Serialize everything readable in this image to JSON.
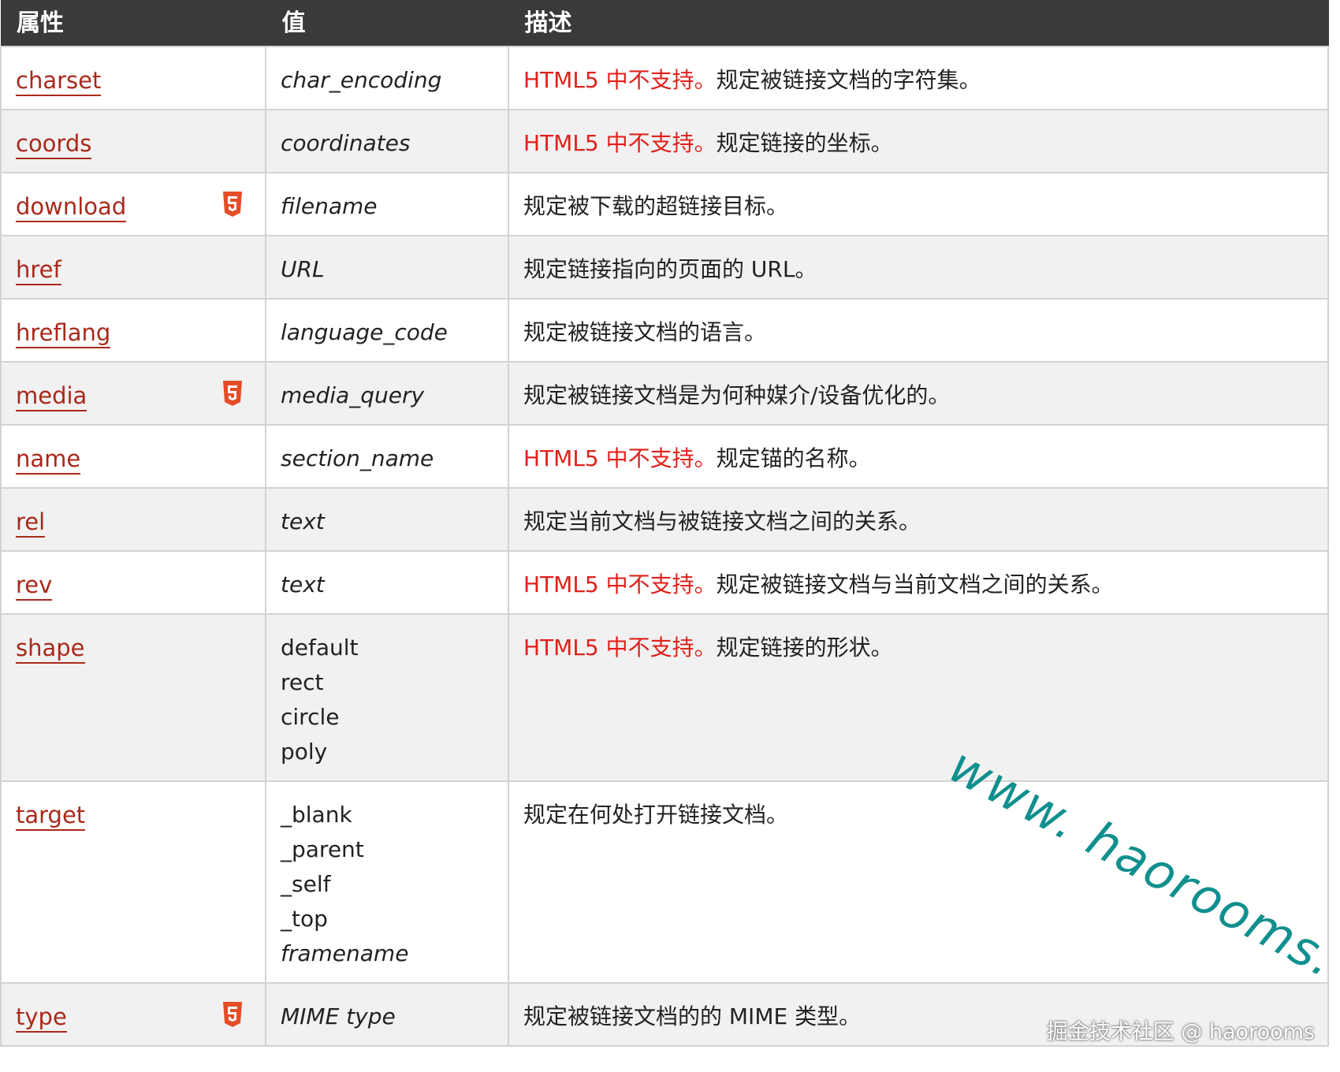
{
  "header": {
    "col_attr": "属性",
    "col_value": "值",
    "col_desc": "描述"
  },
  "rows": [
    {
      "attr": "charset",
      "html5": false,
      "values": [
        "char_encoding"
      ],
      "values_italic": [
        true
      ],
      "unsupported": "HTML5 中不支持。",
      "desc": "规定被链接文档的字符集。"
    },
    {
      "attr": "coords",
      "html5": false,
      "values": [
        "coordinates"
      ],
      "values_italic": [
        true
      ],
      "unsupported": "HTML5 中不支持。",
      "desc": "规定链接的坐标。"
    },
    {
      "attr": "download",
      "html5": true,
      "values": [
        "filename"
      ],
      "values_italic": [
        true
      ],
      "unsupported": "",
      "desc": "规定被下载的超链接目标。"
    },
    {
      "attr": "href",
      "html5": false,
      "values": [
        "URL"
      ],
      "values_italic": [
        true
      ],
      "unsupported": "",
      "desc": "规定链接指向的页面的 URL。"
    },
    {
      "attr": "hreflang",
      "html5": false,
      "values": [
        "language_code"
      ],
      "values_italic": [
        true
      ],
      "unsupported": "",
      "desc": "规定被链接文档的语言。"
    },
    {
      "attr": "media",
      "html5": true,
      "values": [
        "media_query"
      ],
      "values_italic": [
        true
      ],
      "unsupported": "",
      "desc": "规定被链接文档是为何种媒介/设备优化的。"
    },
    {
      "attr": "name",
      "html5": false,
      "values": [
        "section_name"
      ],
      "values_italic": [
        true
      ],
      "unsupported": "HTML5 中不支持。",
      "desc": "规定锚的名称。"
    },
    {
      "attr": "rel",
      "html5": false,
      "values": [
        "text"
      ],
      "values_italic": [
        true
      ],
      "unsupported": "",
      "desc": "规定当前文档与被链接文档之间的关系。"
    },
    {
      "attr": "rev",
      "html5": false,
      "values": [
        "text"
      ],
      "values_italic": [
        true
      ],
      "unsupported": "HTML5 中不支持。",
      "desc": "规定被链接文档与当前文档之间的关系。"
    },
    {
      "attr": "shape",
      "html5": false,
      "values": [
        "default",
        "rect",
        "circle",
        "poly"
      ],
      "values_italic": [
        false,
        false,
        false,
        false
      ],
      "unsupported": "HTML5 中不支持。",
      "desc": "规定链接的形状。"
    },
    {
      "attr": "target",
      "html5": false,
      "values": [
        "_blank",
        "_parent",
        "_self",
        "_top",
        "framename"
      ],
      "values_italic": [
        false,
        false,
        false,
        false,
        true
      ],
      "unsupported": "",
      "desc": "规定在何处打开链接文档。"
    },
    {
      "attr": "type",
      "html5": true,
      "values": [
        "MIME type"
      ],
      "values_italic": [
        true
      ],
      "unsupported": "",
      "desc": "规定被链接文档的的 MIME 类型。"
    }
  ],
  "watermark": "www. haorooms. com",
  "footer_mark": "掘金技术社区 @ haorooms",
  "colors": {
    "header_bg": "#3a3a3a",
    "link": "#a9291b",
    "unsupported": "#e0201b",
    "watermark": "#0f8f8d",
    "html5_badge": "#e44d26"
  }
}
